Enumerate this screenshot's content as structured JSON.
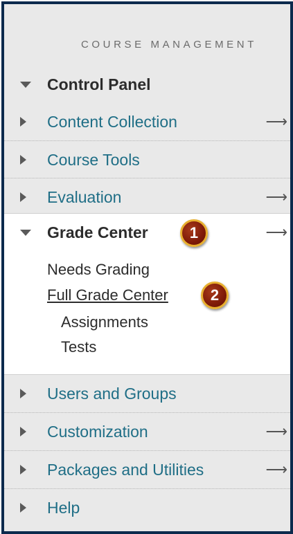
{
  "section_heading": "COURSE MANAGEMENT",
  "menu": {
    "control_panel": "Control Panel",
    "content_collection": "Content Collection",
    "course_tools": "Course Tools",
    "evaluation": "Evaluation",
    "grade_center": "Grade Center",
    "grade_center_items": {
      "needs_grading": "Needs Grading",
      "full_grade_center": "Full Grade Center",
      "assignments": "Assignments",
      "tests": "Tests"
    },
    "users_and_groups": "Users and Groups",
    "customization": "Customization",
    "packages_and_utilities": "Packages and Utilities",
    "help": "Help"
  },
  "callouts": {
    "step1": "1",
    "step2": "2"
  },
  "arrow_glyph": "⟶",
  "colors": {
    "frame": "#0c2a4d",
    "link": "#1f6e86",
    "badge": "#7e1a08",
    "badge_ring": "#e8b030"
  }
}
